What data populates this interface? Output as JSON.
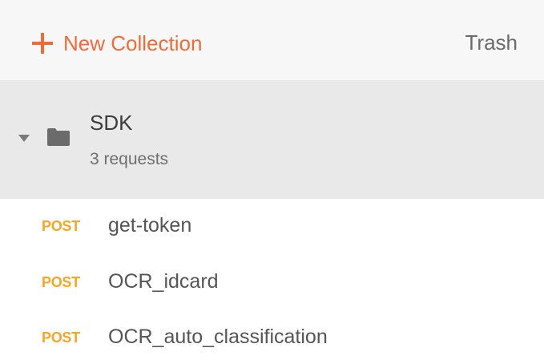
{
  "toolbar": {
    "new_collection_label": "New Collection",
    "trash_label": "Trash",
    "accent_color": "#ef6c3a",
    "plus_icon": "plus-icon"
  },
  "collection": {
    "name": "SDK",
    "count_label": "3 requests",
    "expanded": true,
    "caret_icon": "caret-down-icon",
    "folder_icon": "folder-icon"
  },
  "requests": [
    {
      "method": "POST",
      "name": "get-token"
    },
    {
      "method": "POST",
      "name": "OCR_idcard"
    },
    {
      "method": "POST",
      "name": "OCR_auto_classification"
    }
  ],
  "colors": {
    "method_post": "#f5a623",
    "collection_background": "#e9e9e9"
  }
}
